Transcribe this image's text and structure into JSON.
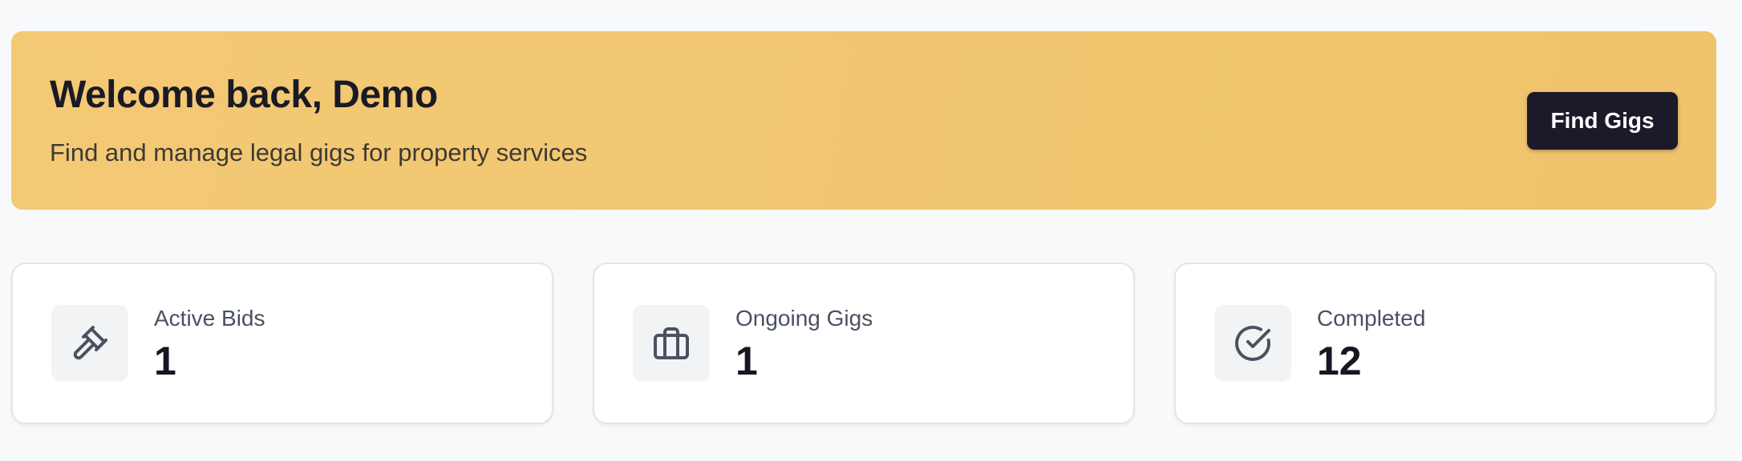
{
  "banner": {
    "title": "Welcome back, Demo",
    "subtitle": "Find and manage legal gigs for property services",
    "button_label": "Find Gigs",
    "background_color": "#f1c66f"
  },
  "stats": [
    {
      "label": "Active Bids",
      "value": "1",
      "icon": "gavel-icon"
    },
    {
      "label": "Ongoing Gigs",
      "value": "1",
      "icon": "briefcase-icon"
    },
    {
      "label": "Completed",
      "value": "12",
      "icon": "check-circle-icon"
    }
  ],
  "colors": {
    "page_background": "#f8f9fb",
    "button_background": "#1c1a29",
    "icon_stroke": "#4a5160"
  }
}
